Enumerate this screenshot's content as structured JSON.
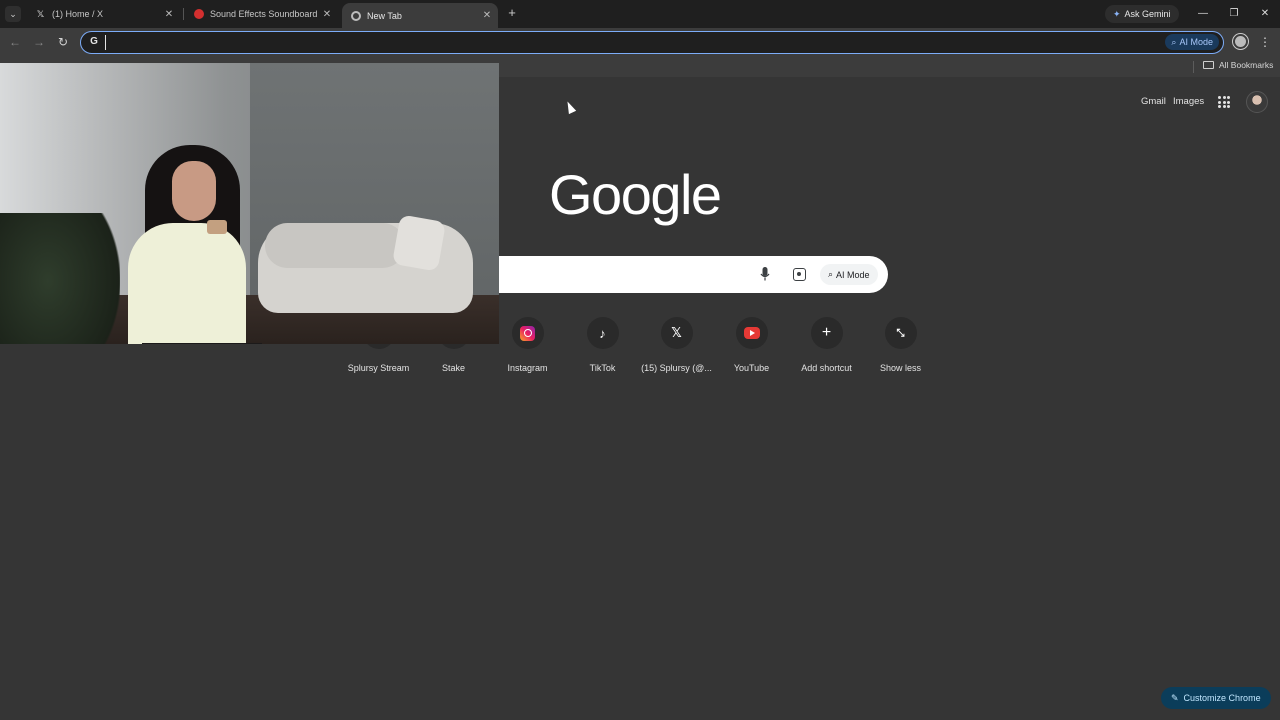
{
  "browser": {
    "tabs": [
      {
        "title": "(1) Home / X",
        "icon": "x-logo-icon",
        "active": false
      },
      {
        "title": "Sound Effects Soundboard - Ca",
        "icon": "soundboard-favicon-icon",
        "active": false
      },
      {
        "title": "New Tab",
        "icon": "chrome-icon",
        "active": true
      }
    ],
    "ask_gemini": "Ask Gemini",
    "omnibox": {
      "value": "",
      "ai_mode": "AI Mode"
    },
    "bookmarks": {
      "all_bookmarks": "All Bookmarks"
    }
  },
  "ntp": {
    "links": {
      "gmail": "Gmail",
      "images": "Images"
    },
    "logo": "Google",
    "search": {
      "ai_mode": "AI Mode"
    },
    "shortcuts": [
      {
        "label": "Splursy Stream",
        "icon": "splursy-stream-icon"
      },
      {
        "label": "Stake",
        "icon": "stake-icon"
      },
      {
        "label": "Instagram",
        "icon": "instagram-icon"
      },
      {
        "label": "TikTok",
        "icon": "tiktok-icon"
      },
      {
        "label": "(15) Splursy (@...",
        "icon": "x-logo-icon"
      },
      {
        "label": "YouTube",
        "icon": "youtube-icon"
      },
      {
        "label": "Add shortcut",
        "icon": "plus-icon"
      },
      {
        "label": "Show less",
        "icon": "collapse-icon"
      }
    ],
    "customize": "Customize Chrome"
  },
  "colors": {
    "accent": "#7cacf8",
    "background": "#353535",
    "customize_bg": "#0b3d5a"
  }
}
